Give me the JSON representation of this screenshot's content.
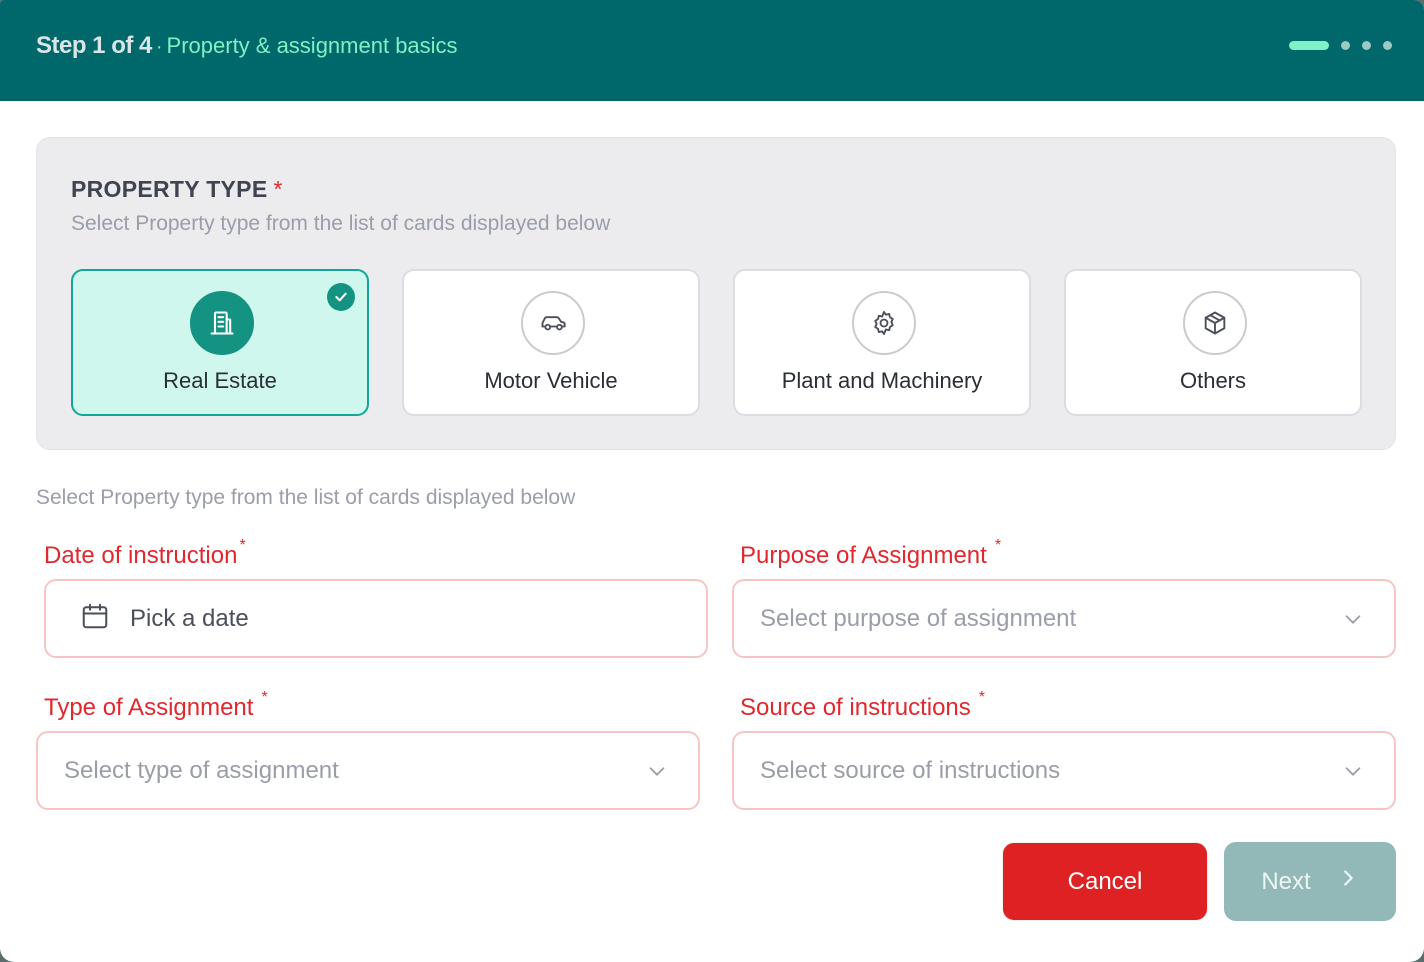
{
  "header": {
    "step": "Step 1 of 4",
    "separator": "·",
    "subtitle": "Property & assignment basics",
    "progress_current": 1,
    "progress_total": 4
  },
  "property_type": {
    "title": "PROPERTY TYPE",
    "required_mark": "*",
    "description": "Select Property type from the list of cards displayed below",
    "selected": "Real Estate",
    "cards": [
      {
        "label": "Real Estate",
        "icon": "building-icon"
      },
      {
        "label": "Motor Vehicle",
        "icon": "car-icon"
      },
      {
        "label": "Plant and Machinery",
        "icon": "gear-icon"
      },
      {
        "label": "Others",
        "icon": "package-icon"
      }
    ]
  },
  "form": {
    "description": "Select Property type from the list of cards displayed below",
    "date_of_instruction": {
      "label": "Date of instruction",
      "required": "*",
      "placeholder": "Pick a date",
      "icon": "calendar-icon"
    },
    "purpose_of_assignment": {
      "label": "Purpose of Assignment",
      "required": "*",
      "placeholder": "Select purpose of assignment"
    },
    "type_of_assignment": {
      "label": "Type of Assignment",
      "required": "*",
      "placeholder": "Select type of assignment"
    },
    "source_of_instructions": {
      "label": "Source of instructions",
      "required": "*",
      "placeholder": "Select source of instructions"
    }
  },
  "actions": {
    "cancel_label": "Cancel",
    "next_label": "Next"
  },
  "colors": {
    "header_bg": "#00676a",
    "accent": "#7ef2c5",
    "selected_card_bg": "#cff7ee",
    "selected_card_border": "#14a596",
    "required_red": "#e0282e",
    "cancel_bg": "#de2224",
    "next_bg": "#92b8b8"
  }
}
